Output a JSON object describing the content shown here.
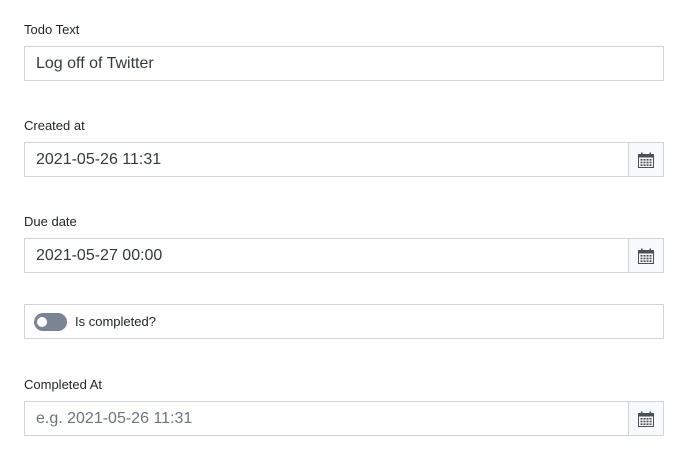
{
  "form": {
    "todo_text": {
      "label": "Todo Text",
      "value": "Log off of Twitter"
    },
    "created_at": {
      "label": "Created at",
      "value": "2021-05-26 11:31",
      "icon": "calendar-icon"
    },
    "due_date": {
      "label": "Due date",
      "value": "2021-05-27 00:00",
      "icon": "calendar-icon"
    },
    "is_completed": {
      "label": "Is completed?",
      "checked": false
    },
    "completed_at": {
      "label": "Completed At",
      "value": "",
      "placeholder": "e.g. 2021-05-26 11:31",
      "icon": "calendar-icon"
    }
  },
  "colors": {
    "border": "#cfd4da",
    "toggle_off": "#7a8494",
    "placeholder": "#6c757d"
  }
}
